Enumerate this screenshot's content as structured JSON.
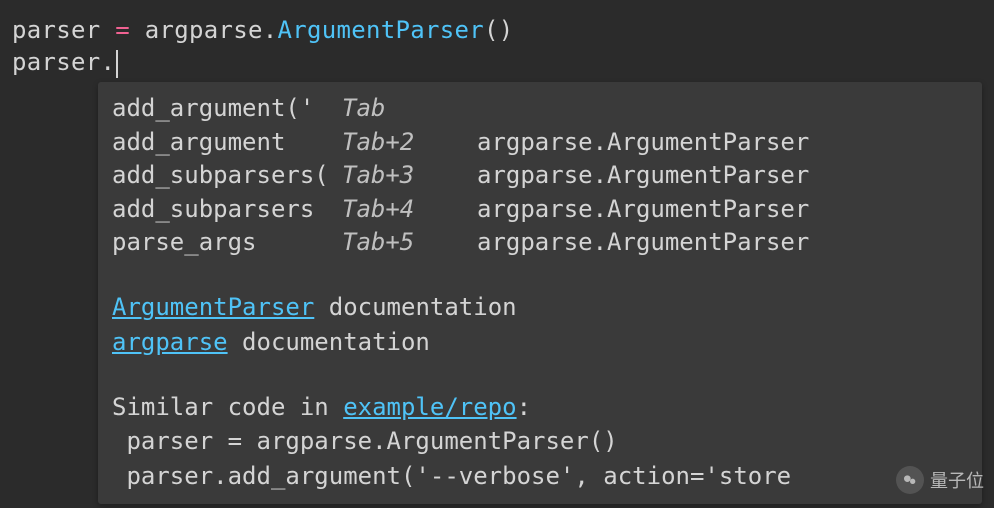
{
  "code": {
    "line1": {
      "var": "parser",
      "space1": " ",
      "op": "=",
      "space2": " ",
      "module": "argparse",
      "dot": ".",
      "class": "ArgumentParser",
      "paren": "()"
    },
    "line2": {
      "var": "parser",
      "dot": "."
    }
  },
  "popup": {
    "completions": [
      {
        "text": "add_argument('",
        "key": "Tab",
        "origin": ""
      },
      {
        "text": "add_argument",
        "key": "Tab+2",
        "origin": "argparse.ArgumentParser"
      },
      {
        "text": "add_subparsers(",
        "key": "Tab+3",
        "origin": "argparse.ArgumentParser"
      },
      {
        "text": "add_subparsers",
        "key": "Tab+4",
        "origin": "argparse.ArgumentParser"
      },
      {
        "text": "parse_args",
        "key": "Tab+5",
        "origin": "argparse.ArgumentParser"
      }
    ],
    "docs": [
      {
        "link": "ArgumentParser",
        "suffix": " documentation"
      },
      {
        "link": "argparse",
        "suffix": " documentation"
      }
    ],
    "similar": {
      "prefix": "Similar code in ",
      "link": "example/repo",
      "suffix": ":",
      "lines": [
        " parser = argparse.ArgumentParser()",
        " parser.add_argument('--verbose', action='store"
      ]
    }
  },
  "watermark": {
    "text": "量子位"
  }
}
